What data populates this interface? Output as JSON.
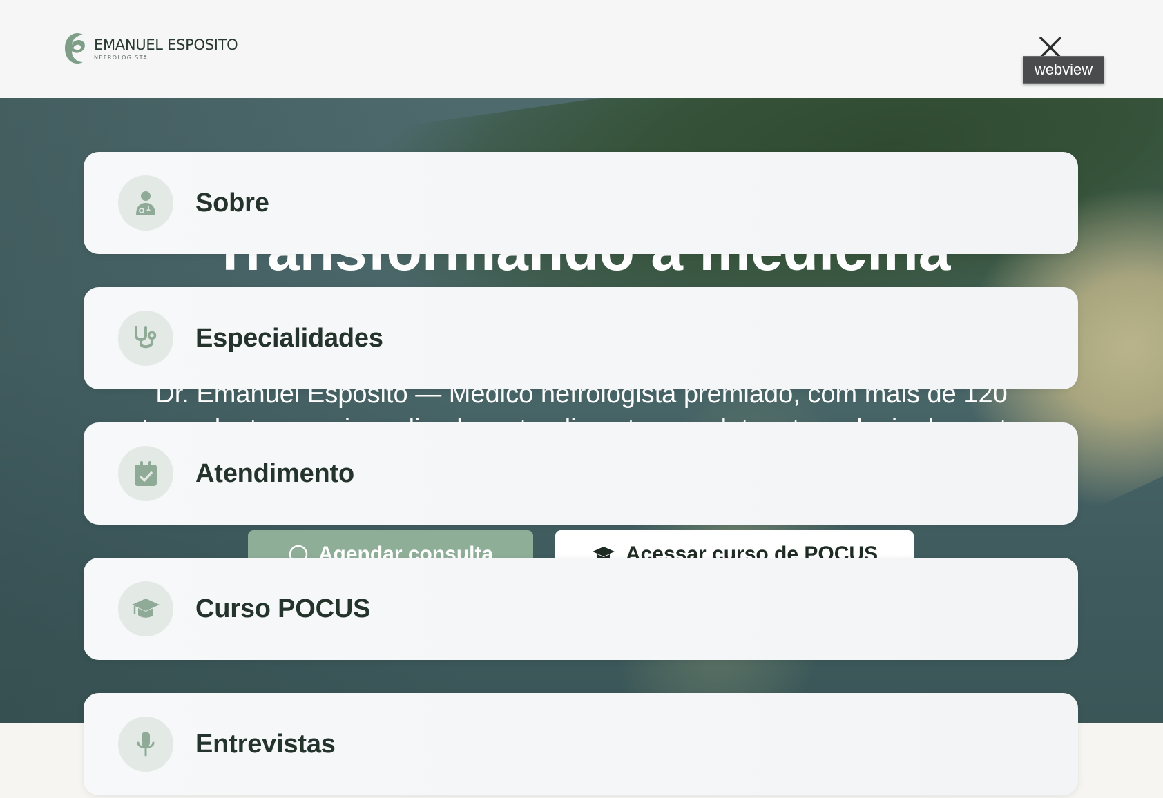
{
  "header": {
    "logo_name": "EMANUEL ESPOSITO",
    "logo_subtitle": "NEFROLOGISTA",
    "close_icon": "close-icon",
    "tooltip": "webview"
  },
  "hero": {
    "title": "Transformando a medicina",
    "subtitle": "Dr. Emanuel Esposito — Médico nefrologista premiado, com mais de 120 transplantes renais realizados, atendimento completo e tecnologia de ponta",
    "primary_cta": {
      "label": "Agendar consulta",
      "icon": "whatsapp-icon"
    },
    "secondary_cta": {
      "label": "Acessar curso de POCUS",
      "icon": "graduation-cap-icon"
    }
  },
  "menu": {
    "items": [
      {
        "label": "Sobre",
        "icon": "doctor-icon"
      },
      {
        "label": "Especialidades",
        "icon": "stethoscope-icon"
      },
      {
        "label": "Atendimento",
        "icon": "calendar-check-icon"
      },
      {
        "label": "Curso POCUS",
        "icon": "graduation-cap-icon"
      },
      {
        "label": "Entrevistas",
        "icon": "microphone-icon"
      }
    ]
  },
  "colors": {
    "brand_green": "#8fae98",
    "icon_green": "#8fab97",
    "icon_bg": "#e3e9e5",
    "text_dark": "#24332b"
  }
}
